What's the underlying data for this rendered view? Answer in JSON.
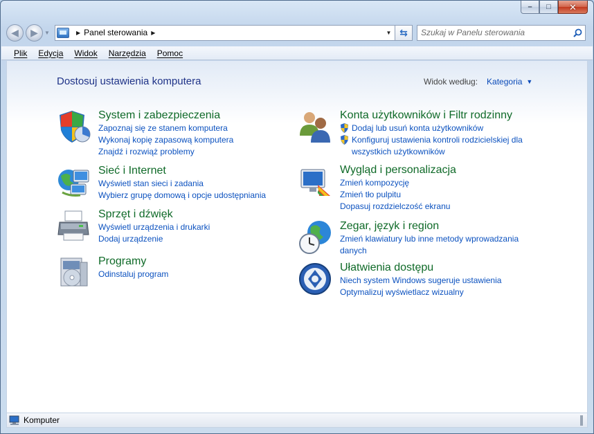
{
  "window": {
    "caption_buttons": {
      "minimize": "–",
      "maximize": "□",
      "close": "✕"
    }
  },
  "nav": {
    "back_icon": "back-arrow",
    "forward_icon": "forward-arrow",
    "breadcrumb": [
      "Panel sterowania"
    ],
    "search_placeholder": "Szukaj w Panelu sterowania"
  },
  "menu": [
    "Plik",
    "Edycja",
    "Widok",
    "Narzędzia",
    "Pomoc"
  ],
  "main": {
    "title": "Dostosuj ustawienia komputera",
    "view_by_label": "Widok według:",
    "view_by_value": "Kategoria"
  },
  "categories_left": [
    {
      "title": "System i zabezpieczenia",
      "icon": "shield-chart-icon",
      "links": [
        "Zapoznaj się ze stanem komputera",
        "Wykonaj kopię zapasową komputera",
        "Znajdź i rozwiąż problemy"
      ]
    },
    {
      "title": "Sieć i Internet",
      "icon": "network-icon",
      "links": [
        "Wyświetl stan sieci i zadania",
        "Wybierz grupę domową i opcje udostępniania"
      ]
    },
    {
      "title": "Sprzęt i dźwięk",
      "icon": "printer-icon",
      "links": [
        "Wyświetl urządzenia i drukarki",
        "Dodaj urządzenie"
      ]
    },
    {
      "title": "Programy",
      "icon": "programs-icon",
      "links": [
        "Odinstaluj program"
      ]
    }
  ],
  "categories_right": [
    {
      "title": "Konta użytkowników i Filtr rodzinny",
      "icon": "users-icon",
      "links": [
        "Dodaj lub usuń konta użytkowników",
        "Konfiguruj ustawienia kontroli rodzicielskiej dla",
        "wszystkich użytkowników"
      ]
    },
    {
      "title": "Wygląd i personalizacja",
      "icon": "display-icon",
      "links": [
        "Zmień kompozycję",
        "Zmień tło pulpitu",
        "Dopasuj rozdzielczość ekranu"
      ]
    },
    {
      "title": "Zegar, język i region",
      "icon": "globe-clock-icon",
      "links": [
        "Zmień klawiatury lub inne metody wprowadzania",
        "danych"
      ]
    },
    {
      "title": "Ułatwienia dostępu",
      "icon": "accessibility-icon",
      "links": [
        "Niech system Windows sugeruje ustawienia",
        "Optymalizuj wyświetlacz wizualny"
      ]
    }
  ],
  "status": {
    "text": "Komputer"
  },
  "colors": {
    "category_title": "#0f6a28",
    "link": "#0b51bf",
    "heading": "#1e3287"
  }
}
